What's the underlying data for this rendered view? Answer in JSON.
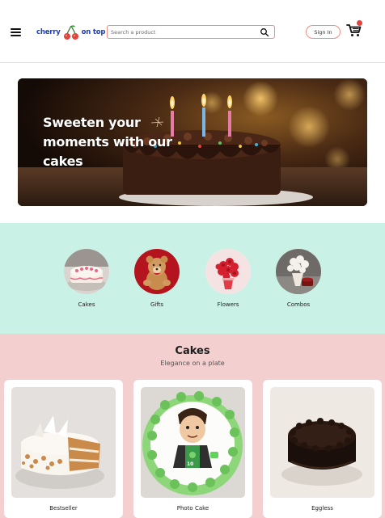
{
  "header": {
    "logo": {
      "left_text": "cherry",
      "right_text": "on top"
    },
    "search": {
      "placeholder": "Search a product"
    },
    "signin_label": "Sign In",
    "cart_count": ""
  },
  "hero": {
    "headline": "Sweeten your moments with our cakes"
  },
  "categories": {
    "items": [
      {
        "label": "Cakes",
        "icon": "cake-image"
      },
      {
        "label": "Gifts",
        "icon": "teddy-bear-image"
      },
      {
        "label": "Flowers",
        "icon": "flower-bouquet-image"
      },
      {
        "label": "Combos",
        "icon": "combo-image"
      }
    ]
  },
  "cakes": {
    "title": "Cakes",
    "subtitle": "Elegance on a plate",
    "cards": [
      {
        "label": "Bestseller"
      },
      {
        "label": "Photo Cake"
      },
      {
        "label": "Eggless"
      }
    ]
  },
  "colors": {
    "brand_blue": "#1f3fb8",
    "accent_red": "#e2433b",
    "mint_bg": "#c9f1e6",
    "pink_bg": "#f3cfcf",
    "search_border": "#e98f86"
  }
}
